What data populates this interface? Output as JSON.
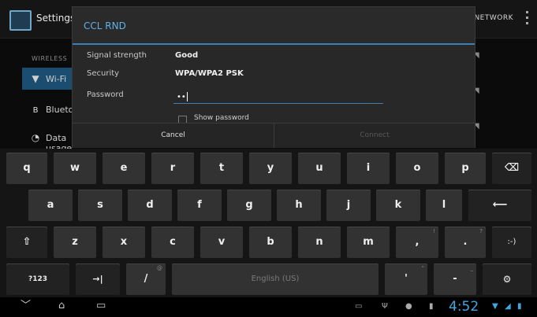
{
  "settings_screen": {
    "title": "Settings",
    "add_network": "ADD NETWORK",
    "section_label": "WIRELESS",
    "items": [
      {
        "label": "Wi-Fi",
        "icon": "wifi-icon"
      },
      {
        "label": "Bluetooth",
        "icon": "bluetooth-icon"
      },
      {
        "label": "Data usage",
        "icon": "data-usage-icon"
      }
    ]
  },
  "dialog": {
    "title": "CCL RND",
    "signal_label": "Signal strength",
    "signal_value": "Good",
    "security_label": "Security",
    "security_value": "WPA/WPA2 PSK",
    "password_label": "Password",
    "password_value": "••",
    "show_password_label": "Show password",
    "cancel_label": "Cancel",
    "connect_label": "Connect"
  },
  "keyboard": {
    "row1": [
      "q",
      "w",
      "e",
      "r",
      "t",
      "y",
      "u",
      "i",
      "o",
      "p"
    ],
    "row2": [
      "a",
      "s",
      "d",
      "f",
      "g",
      "h",
      "j",
      "k",
      "l"
    ],
    "row3": [
      "z",
      "x",
      "c",
      "v",
      "b",
      "n",
      "m"
    ],
    "row3_extra": [
      ",",
      "."
    ],
    "row3_extra_alt": [
      "!",
      "?"
    ],
    "smiley": ":-)",
    "symbols": "?123",
    "tab": "→|",
    "slash": "/",
    "slash_alt": "@",
    "space": "English (US)",
    "apostrophe": "'",
    "apostrophe_alt": "\"",
    "dash": "-",
    "dash_alt": "_",
    "settings_key": "⚙"
  },
  "status_bar": {
    "time": "4:52"
  },
  "colors": {
    "accent": "#3b7fb4",
    "title_blue": "#5fb1e6",
    "clock_blue": "#41a6e0"
  }
}
